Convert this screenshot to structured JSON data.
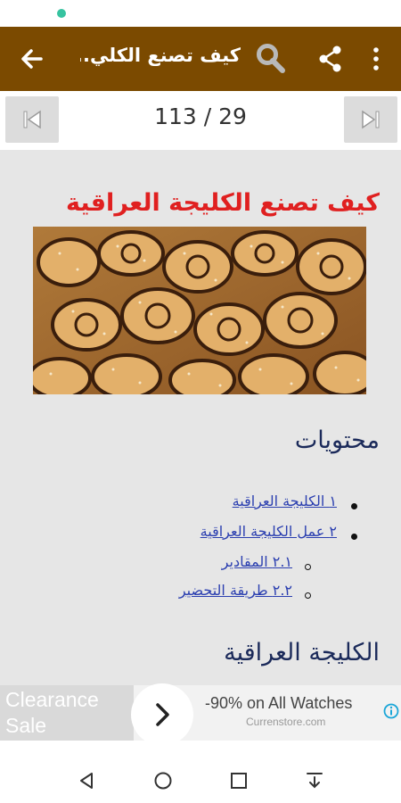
{
  "app_bar": {
    "title": "كيف تصنع الكلي...",
    "back_icon": "arrow-left-icon",
    "search_icon": "magnifier-icon",
    "share_icon": "share-icon",
    "more_icon": "more-vertical-icon",
    "color": "#7b4a00"
  },
  "pager": {
    "count_text": "113 / 29",
    "prev_icon": "skip-previous-icon",
    "next_icon": "skip-next-icon"
  },
  "article": {
    "title": "كيف تصنع الكليجة العراقية",
    "title_color": "#e02020",
    "image_name": "kleicha-pastry-photo"
  },
  "toc": {
    "heading": "محتويات",
    "items": [
      {
        "label": "١ الكليجة العراقية"
      },
      {
        "label": "٢ عمل الكليجة العراقية"
      },
      {
        "label": "٢.١ المقادير"
      },
      {
        "label": "٢.٢ طريقة التحضير"
      }
    ]
  },
  "section": {
    "heading": "الكليجة العراقية"
  },
  "ad": {
    "left_text": "Clearance Sale",
    "headline": "-90% on All Watches",
    "source": "Currenstore.com",
    "arrow_icon": "chevron-right-icon",
    "info_icon": "info-icon"
  },
  "nav": {
    "back_icon": "nav-back-triangle-icon",
    "home_icon": "nav-home-circle-icon",
    "recents_icon": "nav-recents-square-icon",
    "menu_icon": "nav-down-arrow-icon"
  }
}
